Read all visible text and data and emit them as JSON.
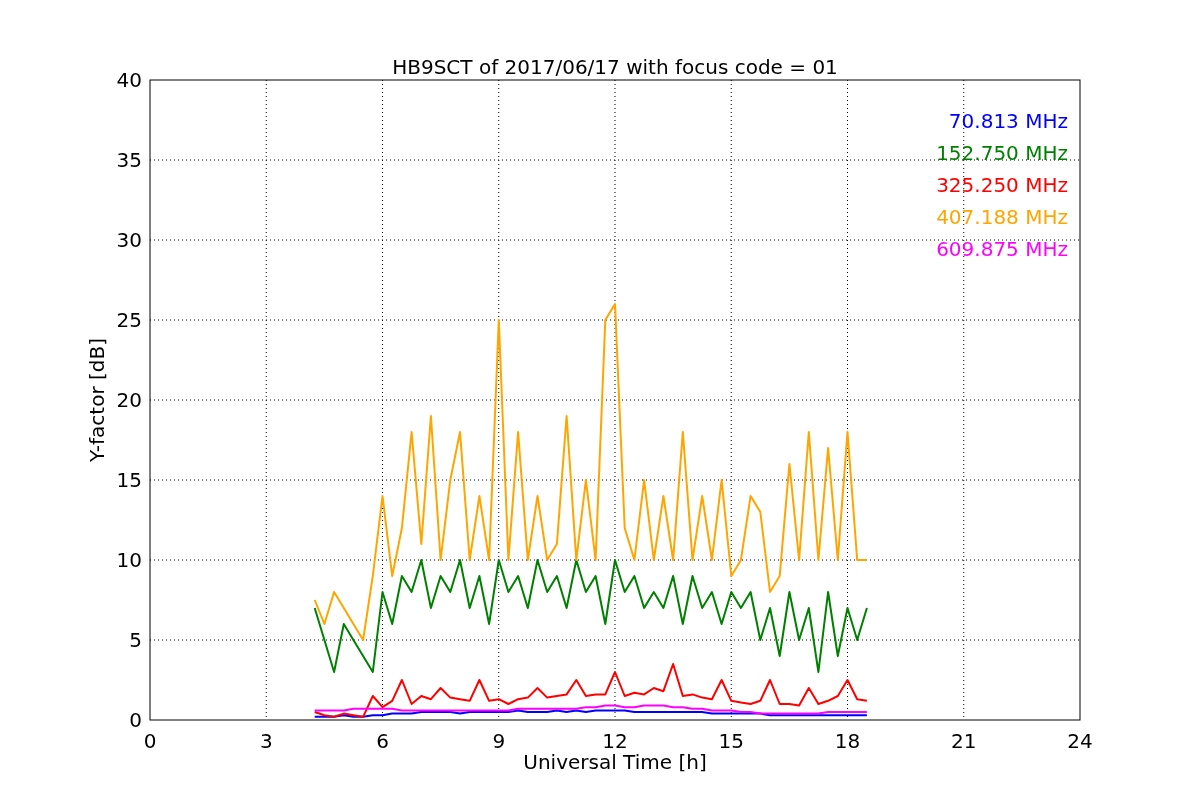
{
  "chart_data": {
    "type": "line",
    "title": "HB9SCT of 2017/06/17 with focus code = 01",
    "xlabel": "Universal Time [h]",
    "ylabel": "Y-factor [dB]",
    "x": [
      4.25,
      4.5,
      4.75,
      5,
      5.25,
      5.5,
      5.75,
      6,
      6.25,
      6.5,
      6.75,
      7,
      7.25,
      7.5,
      7.75,
      8,
      8.25,
      8.5,
      8.75,
      9,
      9.25,
      9.5,
      9.75,
      10,
      10.25,
      10.5,
      10.75,
      11,
      11.25,
      11.5,
      11.75,
      12,
      12.25,
      12.5,
      12.75,
      13,
      13.25,
      13.5,
      13.75,
      14,
      14.25,
      14.5,
      14.75,
      15,
      15.25,
      15.5,
      15.75,
      16,
      16.25,
      16.5,
      16.75,
      17,
      17.25,
      17.5,
      17.75,
      18,
      18.25,
      18.5
    ],
    "series": [
      {
        "name": "70.813 MHz",
        "color": "#0000ff",
        "values": [
          0.2,
          0.2,
          0.2,
          0.3,
          0.2,
          0.2,
          0.3,
          0.3,
          0.4,
          0.4,
          0.4,
          0.5,
          0.5,
          0.5,
          0.5,
          0.4,
          0.5,
          0.5,
          0.5,
          0.5,
          0.5,
          0.6,
          0.5,
          0.5,
          0.5,
          0.6,
          0.5,
          0.6,
          0.5,
          0.6,
          0.6,
          0.6,
          0.6,
          0.5,
          0.5,
          0.5,
          0.5,
          0.5,
          0.5,
          0.5,
          0.5,
          0.4,
          0.4,
          0.4,
          0.4,
          0.4,
          0.4,
          0.3,
          0.3,
          0.3,
          0.3,
          0.3,
          0.3,
          0.3,
          0.3,
          0.3,
          0.3,
          0.3
        ]
      },
      {
        "name": "152.750 MHz",
        "color": "#008000",
        "values": [
          7,
          5,
          3,
          6,
          5,
          4,
          3,
          8,
          6,
          9,
          8,
          10,
          7,
          9,
          8,
          10,
          7,
          9,
          6,
          10,
          8,
          9,
          7,
          10,
          8,
          9,
          7,
          10,
          8,
          9,
          6,
          10,
          8,
          9,
          7,
          8,
          7,
          9,
          6,
          9,
          7,
          8,
          6,
          8,
          7,
          8,
          5,
          7,
          4,
          8,
          5,
          7,
          3,
          8,
          4,
          7,
          5,
          7
        ]
      },
      {
        "name": "325.250 MHz",
        "color": "#ff0000",
        "values": [
          0.5,
          0.3,
          0.2,
          0.4,
          0.3,
          0.2,
          1.5,
          0.8,
          1.2,
          2.5,
          1,
          1.5,
          1.3,
          2,
          1.4,
          1.3,
          1.2,
          2.5,
          1.2,
          1.3,
          1,
          1.3,
          1.4,
          2,
          1.4,
          1.5,
          1.6,
          2.5,
          1.5,
          1.6,
          1.6,
          3,
          1.5,
          1.7,
          1.6,
          2,
          1.8,
          3.5,
          1.5,
          1.6,
          1.4,
          1.3,
          2.5,
          1.2,
          1.1,
          1,
          1.2,
          2.5,
          1,
          1,
          0.9,
          2,
          1,
          1.2,
          1.5,
          2.5,
          1.3,
          1.2
        ]
      },
      {
        "name": "407.188 MHz",
        "color": "#ffa500",
        "values": [
          7.5,
          6,
          8,
          7,
          6,
          5,
          9,
          14,
          9,
          12,
          18,
          11,
          19,
          10,
          15,
          18,
          10,
          14,
          10,
          25,
          10,
          18,
          10,
          14,
          10,
          11,
          19,
          10,
          15,
          10,
          25,
          26,
          12,
          10,
          15,
          10,
          14,
          10,
          18,
          10,
          14,
          10,
          15,
          9,
          10,
          14,
          13,
          8,
          9,
          16,
          10,
          18,
          10,
          17,
          10,
          18,
          10,
          10
        ]
      },
      {
        "name": "609.875 MHz",
        "color": "#ff00ff",
        "values": [
          0.6,
          0.6,
          0.6,
          0.6,
          0.7,
          0.7,
          0.7,
          0.7,
          0.7,
          0.6,
          0.6,
          0.6,
          0.6,
          0.6,
          0.6,
          0.6,
          0.6,
          0.6,
          0.6,
          0.6,
          0.6,
          0.7,
          0.7,
          0.7,
          0.7,
          0.7,
          0.7,
          0.7,
          0.8,
          0.8,
          0.9,
          0.9,
          0.8,
          0.8,
          0.9,
          0.9,
          0.9,
          0.8,
          0.8,
          0.7,
          0.7,
          0.6,
          0.6,
          0.6,
          0.5,
          0.5,
          0.4,
          0.4,
          0.4,
          0.4,
          0.4,
          0.4,
          0.4,
          0.5,
          0.5,
          0.5,
          0.5,
          0.5
        ]
      }
    ],
    "grid": true,
    "xlim": [
      0,
      24
    ],
    "ylim": [
      0,
      40
    ],
    "xticks": [
      0,
      3,
      6,
      9,
      12,
      15,
      18,
      21,
      24
    ],
    "yticks": [
      0,
      5,
      10,
      15,
      20,
      25,
      30,
      35,
      40
    ]
  }
}
